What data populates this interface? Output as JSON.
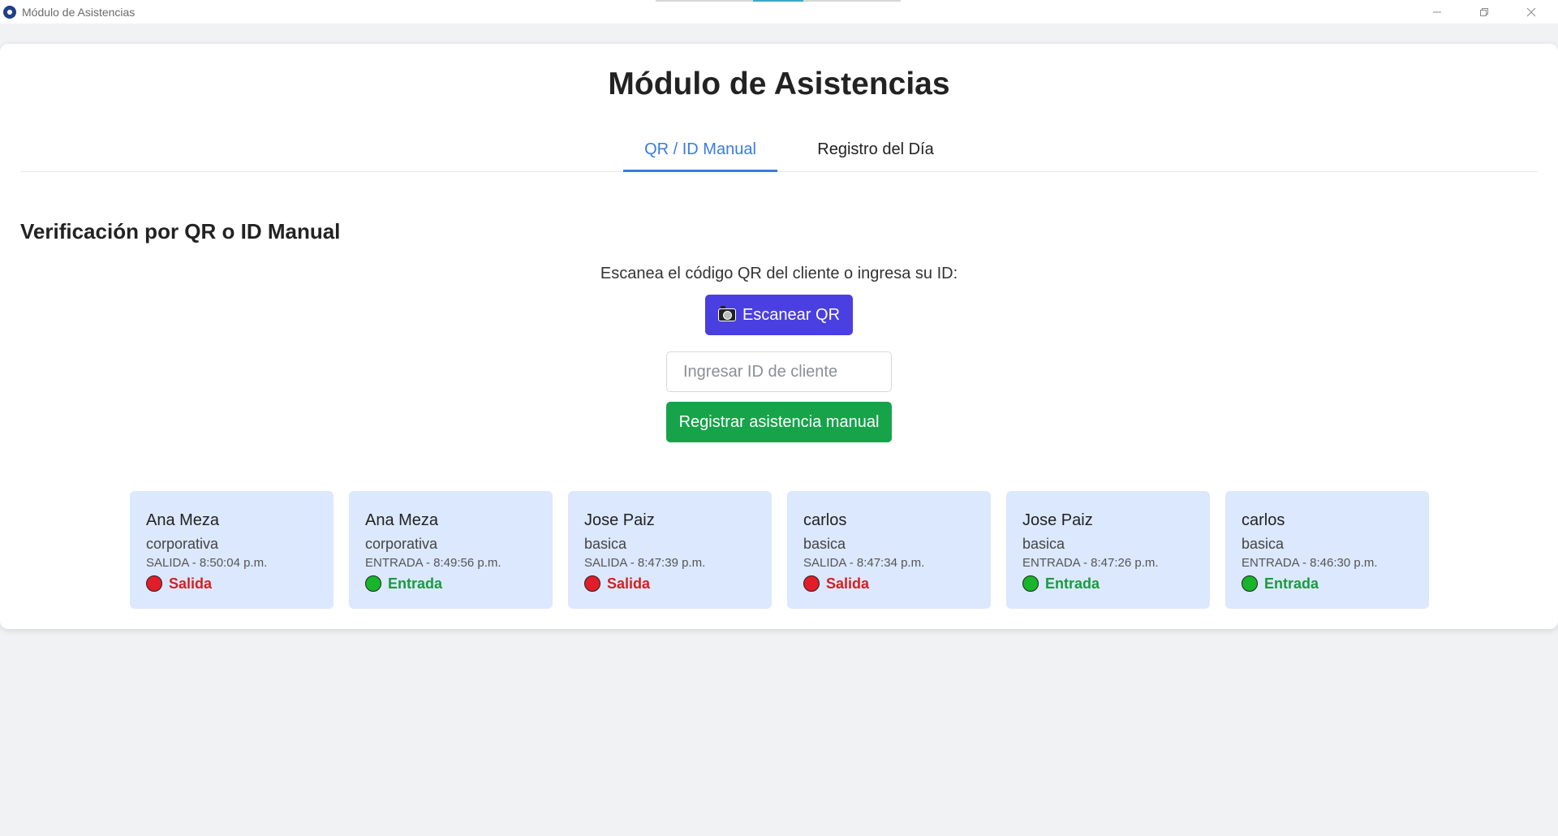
{
  "window": {
    "title": "Módulo de Asistencias"
  },
  "page": {
    "title": "Módulo de Asistencias"
  },
  "tabs": [
    {
      "label": "QR / ID Manual",
      "active": true
    },
    {
      "label": "Registro del Día",
      "active": false
    }
  ],
  "section": {
    "title": "Verificación por QR o ID Manual",
    "prompt": "Escanea el código QR del cliente o ingresa su ID:",
    "scan_button": "Escanear QR",
    "id_input_placeholder": "Ingresar ID de cliente",
    "id_input_value": "",
    "manual_button": "Registrar asistencia manual"
  },
  "records": [
    {
      "name": "Ana Meza",
      "plan": "corporativa",
      "event": "SALIDA - 8:50:04 p.m.",
      "status": "Salida",
      "type": "salida"
    },
    {
      "name": "Ana Meza",
      "plan": "corporativa",
      "event": "ENTRADA - 8:49:56 p.m.",
      "status": "Entrada",
      "type": "entrada"
    },
    {
      "name": "Jose Paiz",
      "plan": "basica",
      "event": "SALIDA - 8:47:39 p.m.",
      "status": "Salida",
      "type": "salida"
    },
    {
      "name": "carlos",
      "plan": "basica",
      "event": "SALIDA - 8:47:34 p.m.",
      "status": "Salida",
      "type": "salida"
    },
    {
      "name": "Jose Paiz",
      "plan": "basica",
      "event": "ENTRADA - 8:47:26 p.m.",
      "status": "Entrada",
      "type": "entrada"
    },
    {
      "name": "carlos",
      "plan": "basica",
      "event": "ENTRADA - 8:46:30 p.m.",
      "status": "Entrada",
      "type": "entrada"
    }
  ],
  "colors": {
    "accent_tab": "#3a7be0",
    "scan_button": "#4a3fe0",
    "manual_button": "#17a34a",
    "card_bg": "#dbe8fd",
    "salida": "#d81e1e",
    "entrada": "#1a9b3e"
  },
  "icons": {
    "scan_button": "camera-icon",
    "window_controls": [
      "minimize-icon",
      "restore-icon",
      "close-icon"
    ]
  }
}
